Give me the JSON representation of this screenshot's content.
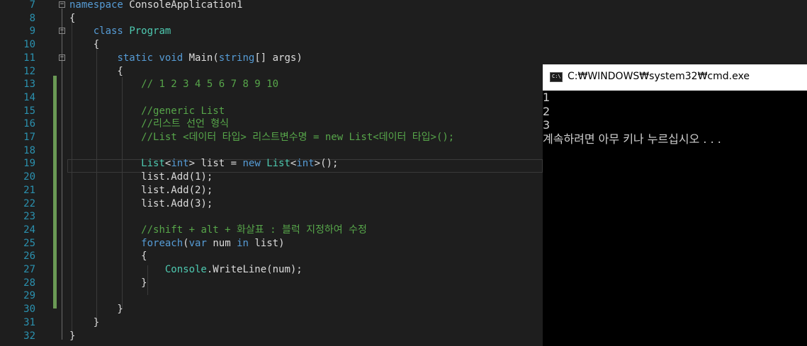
{
  "editor": {
    "lines": [
      {
        "num": "7",
        "parts": [
          {
            "t": "namespace",
            "c": "kw"
          },
          {
            "t": " ConsoleApplication1",
            "c": ""
          }
        ]
      },
      {
        "num": "8",
        "parts": [
          {
            "t": "{",
            "c": ""
          }
        ]
      },
      {
        "num": "9",
        "parts": [
          {
            "t": "    ",
            "c": ""
          },
          {
            "t": "class",
            "c": "kw"
          },
          {
            "t": " ",
            "c": ""
          },
          {
            "t": "Program",
            "c": "ty"
          }
        ]
      },
      {
        "num": "10",
        "parts": [
          {
            "t": "    {",
            "c": ""
          }
        ]
      },
      {
        "num": "11",
        "parts": [
          {
            "t": "        ",
            "c": ""
          },
          {
            "t": "static",
            "c": "kw"
          },
          {
            "t": " ",
            "c": ""
          },
          {
            "t": "void",
            "c": "kw"
          },
          {
            "t": " Main(",
            "c": ""
          },
          {
            "t": "string",
            "c": "kw"
          },
          {
            "t": "[] args)",
            "c": ""
          }
        ]
      },
      {
        "num": "12",
        "parts": [
          {
            "t": "        {",
            "c": ""
          }
        ]
      },
      {
        "num": "13",
        "parts": [
          {
            "t": "            ",
            "c": ""
          },
          {
            "t": "// 1 2 3 4 5 6 7 8 9 10",
            "c": "cm"
          }
        ]
      },
      {
        "num": "14",
        "parts": []
      },
      {
        "num": "15",
        "parts": [
          {
            "t": "            ",
            "c": ""
          },
          {
            "t": "//generic List",
            "c": "cm"
          }
        ]
      },
      {
        "num": "16",
        "parts": [
          {
            "t": "            ",
            "c": ""
          },
          {
            "t": "//리스트 선언 형식",
            "c": "cm"
          }
        ]
      },
      {
        "num": "17",
        "parts": [
          {
            "t": "            ",
            "c": ""
          },
          {
            "t": "//List <데이터 타입> 리스트변수명 = new List<데이터 타입>();",
            "c": "cm"
          }
        ]
      },
      {
        "num": "18",
        "parts": []
      },
      {
        "num": "19",
        "parts": [
          {
            "t": "            ",
            "c": ""
          },
          {
            "t": "List",
            "c": "ty"
          },
          {
            "t": "<",
            "c": ""
          },
          {
            "t": "int",
            "c": "kw"
          },
          {
            "t": "> list = ",
            "c": ""
          },
          {
            "t": "new",
            "c": "kw"
          },
          {
            "t": " ",
            "c": ""
          },
          {
            "t": "List",
            "c": "ty"
          },
          {
            "t": "<",
            "c": ""
          },
          {
            "t": "int",
            "c": "kw"
          },
          {
            "t": ">();",
            "c": ""
          }
        ]
      },
      {
        "num": "20",
        "parts": [
          {
            "t": "            list.Add(1);",
            "c": ""
          }
        ]
      },
      {
        "num": "21",
        "parts": [
          {
            "t": "            list.Add(2);",
            "c": ""
          }
        ]
      },
      {
        "num": "22",
        "parts": [
          {
            "t": "            list.Add(3);",
            "c": ""
          }
        ]
      },
      {
        "num": "23",
        "parts": []
      },
      {
        "num": "24",
        "parts": [
          {
            "t": "            ",
            "c": ""
          },
          {
            "t": "//shift + alt + 화살표 : 블럭 지정하여 수정",
            "c": "cm"
          }
        ]
      },
      {
        "num": "25",
        "parts": [
          {
            "t": "            ",
            "c": ""
          },
          {
            "t": "foreach",
            "c": "kw"
          },
          {
            "t": "(",
            "c": ""
          },
          {
            "t": "var",
            "c": "kw"
          },
          {
            "t": " num ",
            "c": ""
          },
          {
            "t": "in",
            "c": "kw"
          },
          {
            "t": " list)",
            "c": ""
          }
        ]
      },
      {
        "num": "26",
        "parts": [
          {
            "t": "            {",
            "c": ""
          }
        ]
      },
      {
        "num": "27",
        "parts": [
          {
            "t": "                ",
            "c": ""
          },
          {
            "t": "Console",
            "c": "ty"
          },
          {
            "t": ".WriteLine(num);",
            "c": ""
          }
        ]
      },
      {
        "num": "28",
        "parts": [
          {
            "t": "            }",
            "c": ""
          }
        ]
      },
      {
        "num": "29",
        "parts": []
      },
      {
        "num": "30",
        "parts": [
          {
            "t": "        }",
            "c": ""
          }
        ]
      },
      {
        "num": "31",
        "parts": [
          {
            "t": "    }",
            "c": ""
          }
        ]
      },
      {
        "num": "32",
        "parts": [
          {
            "t": "}",
            "c": ""
          }
        ]
      }
    ],
    "fold_glyph": "−"
  },
  "cmd": {
    "title": "C:₩WINDOWS₩system32₩cmd.exe",
    "icon_text": "C:\\",
    "output": [
      "1",
      "2",
      "3",
      "계속하려면 아무 키나 누르십시오 . . ."
    ]
  },
  "colors": {
    "keyword": "#569cd6",
    "type": "#4ec9b0",
    "comment": "#57a64a",
    "line_number": "#2b91af",
    "change_bar": "#6a9955"
  }
}
